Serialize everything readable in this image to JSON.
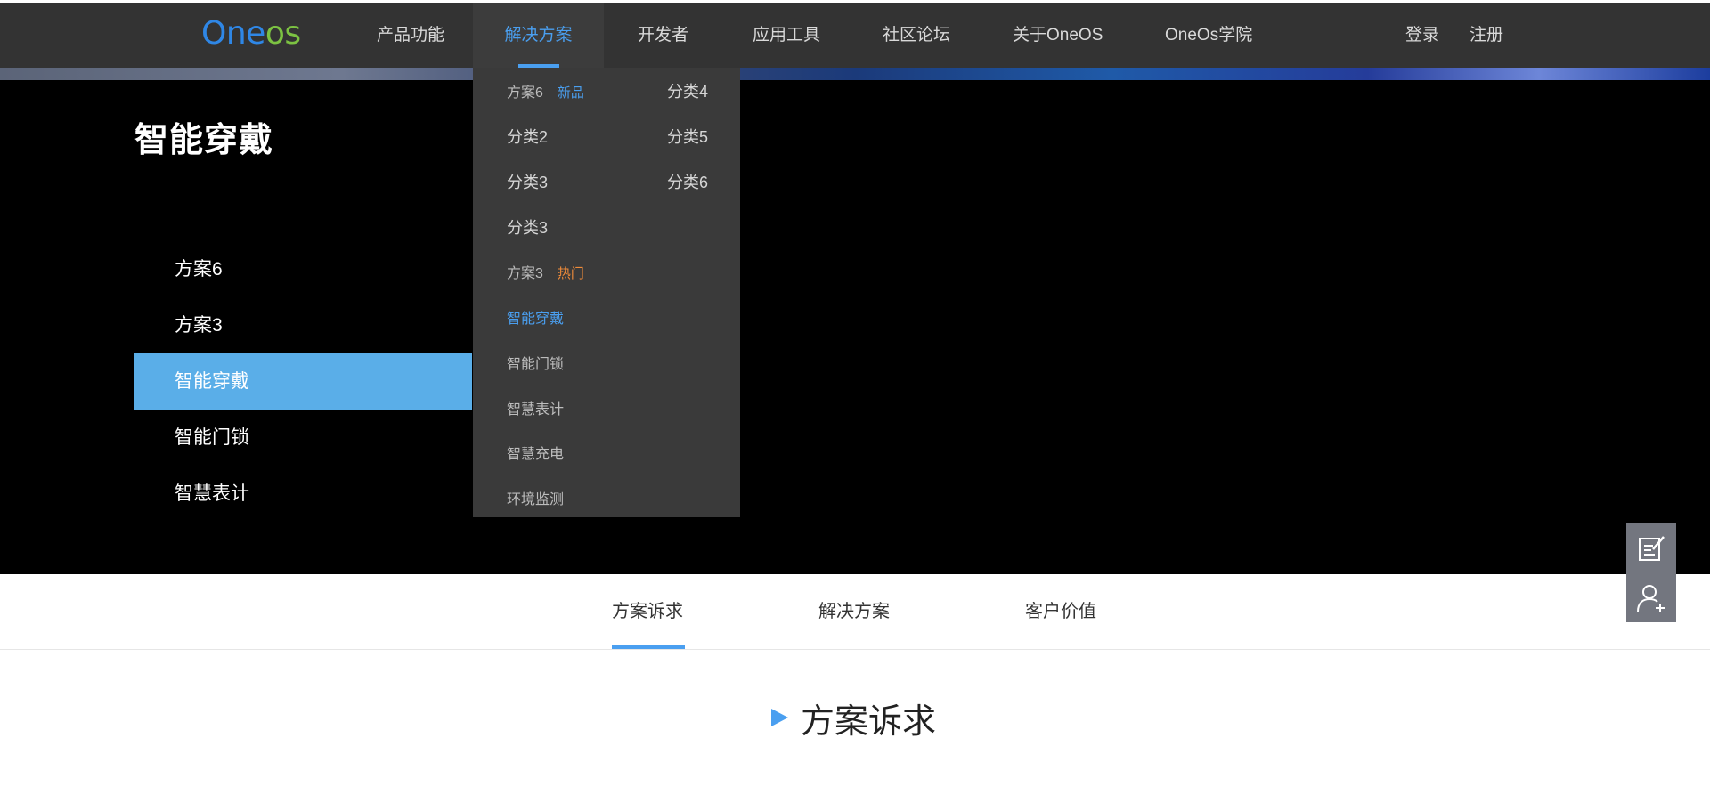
{
  "logo": {
    "part1": "O",
    "part2": "ne",
    "part3": "os"
  },
  "nav": {
    "items": [
      {
        "label": "产品功能"
      },
      {
        "label": "解决方案"
      },
      {
        "label": "开发者"
      },
      {
        "label": "应用工具"
      },
      {
        "label": "社区论坛"
      },
      {
        "label": "关于OneOS"
      },
      {
        "label": "OneOs学院"
      }
    ],
    "login": "登录",
    "register": "注册",
    "active_index": 1,
    "accent_color": "#4a9ff0"
  },
  "dropdown": {
    "col1": [
      {
        "label": "方案6",
        "badge": "新品"
      },
      {
        "label": "分类2"
      },
      {
        "label": "分类3"
      },
      {
        "label": "分类3"
      },
      {
        "label": "方案3",
        "badge": "热门"
      },
      {
        "label": "智能穿戴"
      },
      {
        "label": "智能门锁"
      },
      {
        "label": "智慧表计"
      },
      {
        "label": "智慧充电"
      },
      {
        "label": "环境监测"
      }
    ],
    "col2": [
      {
        "label": "分类4"
      },
      {
        "label": "分类5"
      },
      {
        "label": "分类6"
      }
    ]
  },
  "hero": {
    "title": "智能穿戴",
    "menu": [
      {
        "label": "方案6"
      },
      {
        "label": "方案3"
      },
      {
        "label": "智能穿戴",
        "active": true
      },
      {
        "label": "智能门锁"
      },
      {
        "label": "智慧表计"
      }
    ],
    "active_color": "#5aaee8"
  },
  "tabs": {
    "items": [
      {
        "label": "方案诉求",
        "active": true
      },
      {
        "label": "解决方案"
      },
      {
        "label": "客户价值"
      }
    ]
  },
  "section": {
    "title": "方案诉求"
  },
  "float_tools": {
    "icons": [
      "edit-note-icon",
      "add-user-icon"
    ]
  }
}
